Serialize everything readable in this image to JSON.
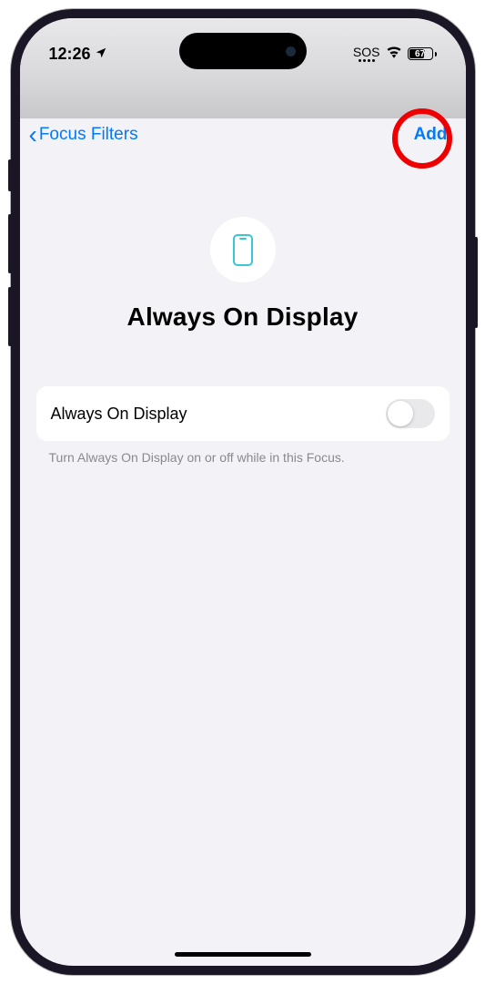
{
  "status": {
    "time": "12:26",
    "sos": "SOS",
    "battery": "67"
  },
  "nav": {
    "back_label": "Focus Filters",
    "add_label": "Add"
  },
  "hero": {
    "title": "Always On Display"
  },
  "setting": {
    "label": "Always On Display",
    "footer": "Turn Always On Display on or off while in this Focus."
  }
}
